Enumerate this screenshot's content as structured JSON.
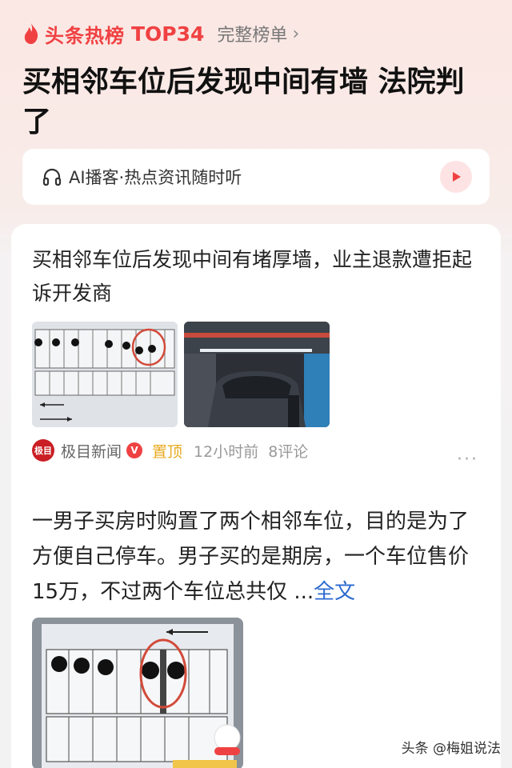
{
  "header": {
    "hot_title": "头条热榜",
    "rank": "TOP34",
    "full_list": "完整榜单",
    "chevron_icon": "chevron-right-icon"
  },
  "headline": "买相邻车位后发现中间有墙 法院判了",
  "podcast": {
    "text": "AI播客·热点资讯随时听",
    "icon": "headphone-icon",
    "play_icon": "play-icon"
  },
  "article": {
    "title": "买相邻车位后发现中间有堵厚墙，业主退款遭拒起诉开发商",
    "source_logo": "极目",
    "source": "极目新闻",
    "verified": "V",
    "pinned": "置顶",
    "time": "12小时前",
    "comments": "8评论",
    "more_icon": "more-icon"
  },
  "post": {
    "summary": "一男子买房时购置了两个相邻车位，目的是为了方便自己停车。男子买的是期房，一个车位售价15万，不过两个车位总共仅",
    "ellipsis": "...",
    "full_text": "全文"
  },
  "watermark": "头条 @梅姐说法",
  "colors": {
    "accent": "#f04142",
    "link": "#2d6bd1",
    "pinned": "#e8a91e"
  }
}
